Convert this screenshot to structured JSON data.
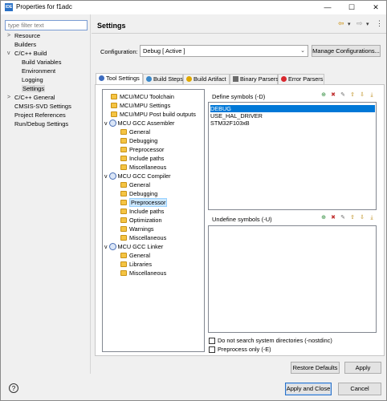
{
  "window": {
    "app_icon_text": "IDE",
    "title": "Properties for f1adc",
    "controls": {
      "minimize": "—",
      "maximize": "☐",
      "close": "✕"
    }
  },
  "left": {
    "filter_placeholder": "type filter text",
    "tree": [
      {
        "label": "Resource",
        "indent": 0,
        "chevron": ">"
      },
      {
        "label": "Builders",
        "indent": 0,
        "chevron": ""
      },
      {
        "label": "C/C++ Build",
        "indent": 0,
        "chevron": "v"
      },
      {
        "label": "Build Variables",
        "indent": 1,
        "chevron": ""
      },
      {
        "label": "Environment",
        "indent": 1,
        "chevron": ""
      },
      {
        "label": "Logging",
        "indent": 1,
        "chevron": ""
      },
      {
        "label": "Settings",
        "indent": 1,
        "chevron": "",
        "selected": true
      },
      {
        "label": "C/C++ General",
        "indent": 0,
        "chevron": ">"
      },
      {
        "label": "CMSIS-SVD Settings",
        "indent": 0,
        "chevron": ""
      },
      {
        "label": "Project References",
        "indent": 0,
        "chevron": ""
      },
      {
        "label": "Run/Debug Settings",
        "indent": 0,
        "chevron": ""
      }
    ]
  },
  "header": {
    "title": "Settings",
    "back_icon": "⇦",
    "back_dropdown": "▾",
    "forward_icon": "⇨",
    "forward_dropdown": "▾",
    "menu_icon": "⋮"
  },
  "config": {
    "label": "Configuration:",
    "value": "Debug  [ Active ]",
    "dropdown_arrow": "⌄",
    "manage_button": "Manage Configurations..."
  },
  "tabs": [
    {
      "label": "Tool Settings",
      "active": true,
      "icon_color": "#3c6bbf"
    },
    {
      "label": "Build Steps",
      "active": false,
      "icon_color": "#3b88c9"
    },
    {
      "label": "Build Artifact",
      "active": false,
      "icon_color": "#e0a800"
    },
    {
      "label": "Binary Parsers",
      "active": false,
      "icon_color": "#6b6b6b"
    },
    {
      "label": "Error Parsers",
      "active": false,
      "icon_color": "#d9282f"
    }
  ],
  "tool_tree": [
    {
      "label": "MCU/MCU Toolchain",
      "type": "folder",
      "indent": 0
    },
    {
      "label": "MCU/MPU Settings",
      "type": "folder",
      "indent": 0
    },
    {
      "label": "MCU/MPU Post build outputs",
      "type": "folder",
      "indent": 0
    },
    {
      "label": "MCU GCC Assembler",
      "type": "gear",
      "indent": 0,
      "expanded": true
    },
    {
      "label": "General",
      "type": "folder",
      "indent": 1
    },
    {
      "label": "Debugging",
      "type": "folder",
      "indent": 1
    },
    {
      "label": "Preprocessor",
      "type": "folder",
      "indent": 1
    },
    {
      "label": "Include paths",
      "type": "folder",
      "indent": 1
    },
    {
      "label": "Miscellaneous",
      "type": "folder",
      "indent": 1
    },
    {
      "label": "MCU GCC Compiler",
      "type": "gear",
      "indent": 0,
      "expanded": true
    },
    {
      "label": "General",
      "type": "folder",
      "indent": 1
    },
    {
      "label": "Debugging",
      "type": "folder",
      "indent": 1
    },
    {
      "label": "Preprocessor",
      "type": "folder",
      "indent": 1,
      "selected": true
    },
    {
      "label": "Include paths",
      "type": "folder",
      "indent": 1
    },
    {
      "label": "Optimization",
      "type": "folder",
      "indent": 1
    },
    {
      "label": "Warnings",
      "type": "folder",
      "indent": 1
    },
    {
      "label": "Miscellaneous",
      "type": "folder",
      "indent": 1
    },
    {
      "label": "MCU GCC Linker",
      "type": "gear",
      "indent": 0,
      "expanded": true
    },
    {
      "label": "General",
      "type": "folder",
      "indent": 1
    },
    {
      "label": "Libraries",
      "type": "folder",
      "indent": 1
    },
    {
      "label": "Miscellaneous",
      "type": "folder",
      "indent": 1
    }
  ],
  "define_symbols": {
    "title": "Define symbols (-D)",
    "items": [
      {
        "label": "DEBUG",
        "selected": true
      },
      {
        "label": "USE_HAL_DRIVER",
        "selected": false
      },
      {
        "label": "STM32F103xB",
        "selected": false
      }
    ]
  },
  "undefine_symbols": {
    "title": "Undefine symbols (-U)",
    "items": []
  },
  "checkboxes": [
    {
      "label": "Do not search system directories (-nostdinc)",
      "checked": false
    },
    {
      "label": "Preprocess only (-E)",
      "checked": false
    }
  ],
  "buttons": {
    "restore_defaults": "Restore Defaults",
    "apply": "Apply",
    "apply_and_close": "Apply and Close",
    "cancel": "Cancel"
  },
  "help_icon": "?"
}
